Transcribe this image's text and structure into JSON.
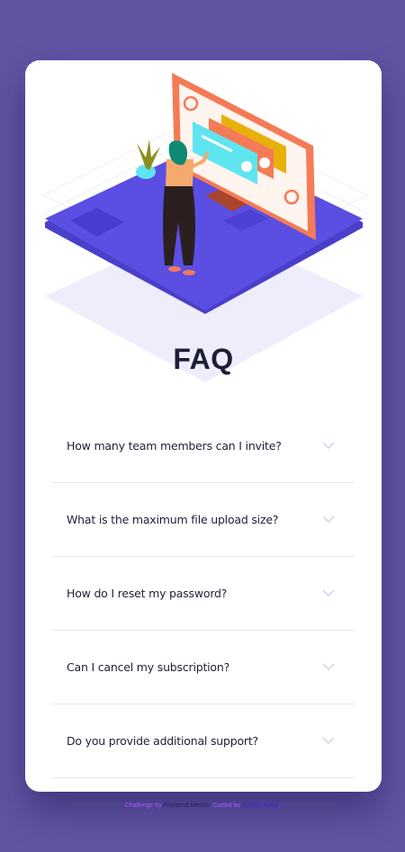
{
  "page": {
    "title": "FAQ"
  },
  "faq": {
    "items": [
      {
        "question": "How many team members can I invite?",
        "icon": "chevron-down-icon"
      },
      {
        "question": "What is the maximum file upload size?",
        "icon": "chevron-down-icon"
      },
      {
        "question": "How do I reset my password?",
        "icon": "chevron-down-icon"
      },
      {
        "question": "Can I cancel my subscription?",
        "icon": "chevron-down-icon"
      },
      {
        "question": "Do you provide additional support?",
        "icon": "chevron-down-icon"
      }
    ]
  },
  "attribution": {
    "prefix": "Challenge by",
    "frontend_mentor": "Frontend Mentor",
    "coded_by": "Coded by",
    "author": "Vasiliki Kollia"
  },
  "colors": {
    "background": "#5f55a3",
    "card": "#ffffff",
    "title": "#1e1f36",
    "platform": "#5b4ee3",
    "monitor": "#f47b56",
    "attribution_accent": "#a35cff"
  }
}
